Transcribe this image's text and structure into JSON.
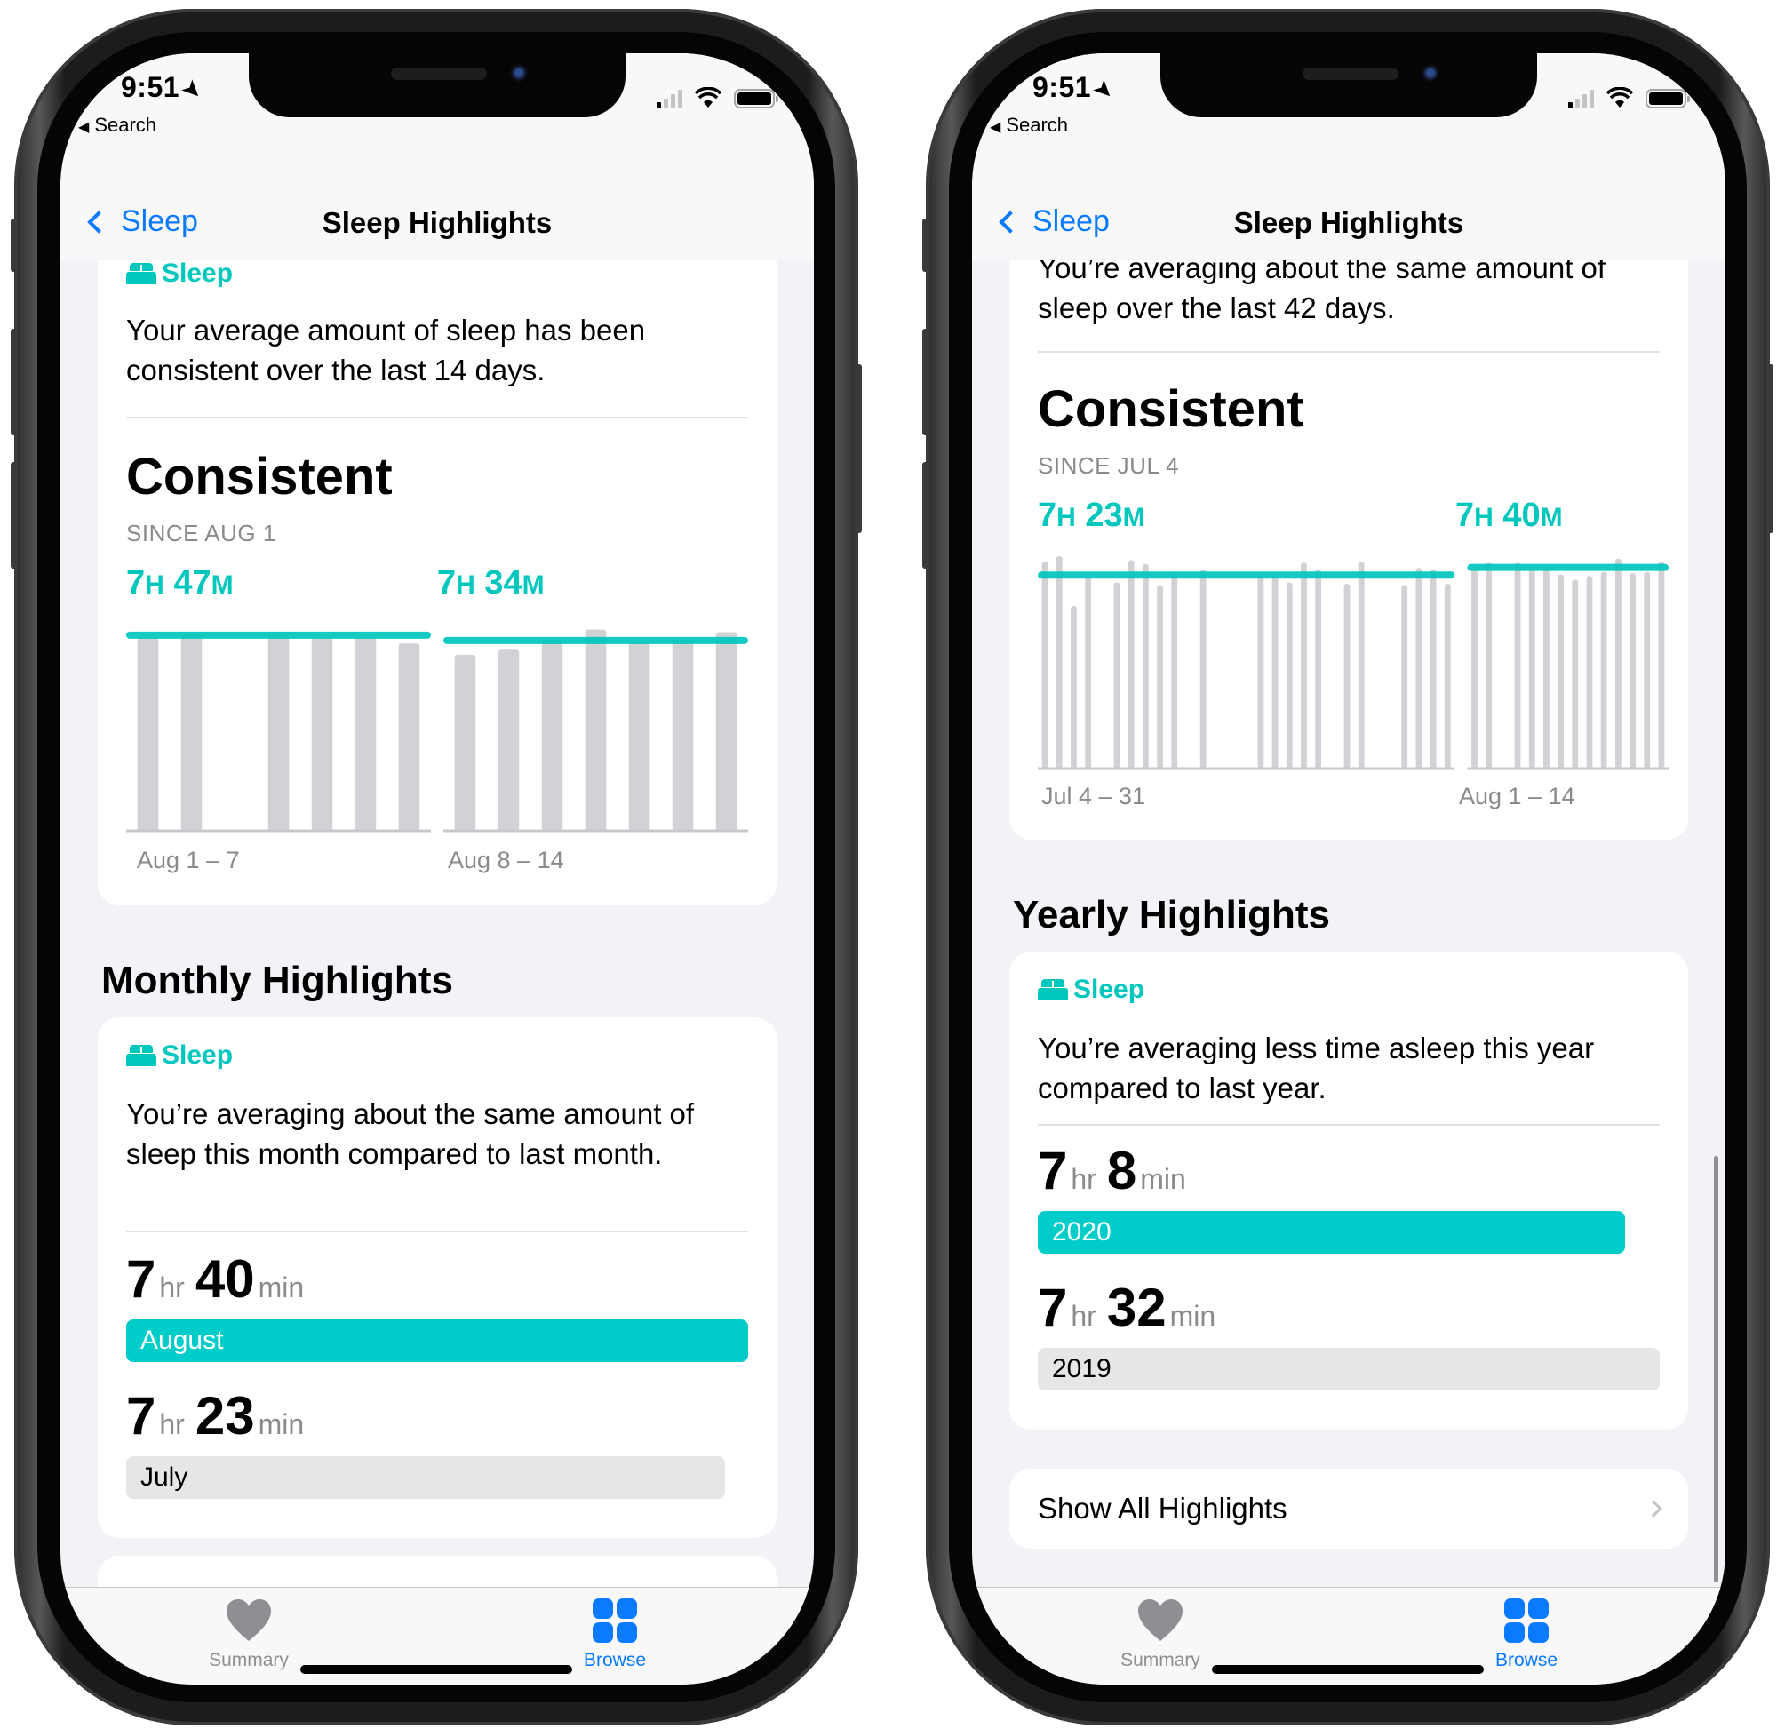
{
  "phones": [
    {
      "status": {
        "time": "9:51",
        "back_app": "Search"
      },
      "nav": {
        "back_label": "Sleep",
        "title": "Sleep Highlights"
      },
      "trend_card": {
        "category": "Sleep",
        "description": "Your average amount of sleep has been consistent over the last 14 days.",
        "status": "Consistent",
        "since": "SINCE AUG 1",
        "periods": [
          {
            "avg_h": "7",
            "avg_m": "47",
            "label": "Aug 1 – 7"
          },
          {
            "avg_h": "7",
            "avg_m": "34",
            "label": "Aug 8 – 14"
          }
        ]
      },
      "section_title": "Monthly Highlights",
      "compare_card": {
        "category": "Sleep",
        "description": "You’re averaging about the same amount of sleep this month compared to last month.",
        "rows": [
          {
            "hr": "7",
            "min": "40",
            "label": "August",
            "fraction": 1.0,
            "current": true
          },
          {
            "hr": "7",
            "min": "23",
            "label": "July",
            "fraction": 0.963,
            "current": false
          }
        ]
      },
      "tabs": [
        {
          "label": "Summary",
          "icon": "heart-icon",
          "active": false
        },
        {
          "label": "Browse",
          "icon": "grid-icon",
          "active": true
        }
      ]
    },
    {
      "status": {
        "time": "9:51",
        "back_app": "Search"
      },
      "nav": {
        "back_label": "Sleep",
        "title": "Sleep Highlights"
      },
      "trend_card": {
        "category": "Sleep",
        "description": "You’re averaging about the same amount of sleep over the last 42 days.",
        "status": "Consistent",
        "since": "SINCE JUL 4",
        "periods": [
          {
            "avg_h": "7",
            "avg_m": "23",
            "label": "Jul 4 – 31"
          },
          {
            "avg_h": "7",
            "avg_m": "40",
            "label": "Aug 1 – 14"
          }
        ]
      },
      "section_title": "Yearly Highlights",
      "compare_card": {
        "category": "Sleep",
        "description": "You’re averaging less time asleep this year compared to last year.",
        "rows": [
          {
            "hr": "7",
            "min": "8",
            "label": "2020",
            "fraction": 0.944,
            "current": true
          },
          {
            "hr": "7",
            "min": "32",
            "label": "2019",
            "fraction": 1.0,
            "current": false
          }
        ]
      },
      "show_all_label": "Show All Highlights",
      "tabs": [
        {
          "label": "Summary",
          "icon": "heart-icon",
          "active": false
        },
        {
          "label": "Browse",
          "icon": "grid-icon",
          "active": true
        }
      ]
    }
  ],
  "colors": {
    "accent_teal": "#00c7be",
    "ios_blue": "#0a7aff",
    "bar_gray": "#d1d1d6"
  },
  "chart_data": [
    {
      "type": "bar",
      "title": "Consistent — SINCE AUG 1",
      "unit": "hours",
      "groups": [
        {
          "label": "Aug 1 – 7",
          "average": 7.78,
          "values": [
            7.7,
            7.8,
            null,
            7.85,
            7.7,
            7.72,
            7.45
          ]
        },
        {
          "label": "Aug 8 – 14",
          "average": 7.57,
          "values": [
            7.0,
            7.2,
            7.6,
            8.0,
            7.5,
            7.6,
            7.9
          ]
        }
      ],
      "ylim": [
        0,
        8.2
      ],
      "grid": false
    },
    {
      "type": "bar",
      "title": "Consistent — SINCE JUL 4",
      "unit": "hours",
      "groups": [
        {
          "label": "Jul 4 – 31",
          "average": 7.38,
          "values": [
            7.9,
            8.1,
            6.2,
            7.3,
            null,
            7.1,
            7.95,
            7.8,
            7.0,
            7.4,
            null,
            7.6,
            null,
            null,
            null,
            7.35,
            7.3,
            7.1,
            7.85,
            7.6,
            null,
            7.05,
            7.9,
            null,
            null,
            7.0,
            7.65,
            7.6,
            7.05
          ]
        },
        {
          "label": "Aug 1 – 14",
          "average": 7.67,
          "values": [
            7.6,
            7.85,
            null,
            7.85,
            7.6,
            7.65,
            7.4,
            7.2,
            7.35,
            7.5,
            8.0,
            7.45,
            7.5,
            7.9
          ]
        }
      ],
      "ylim": [
        0,
        8.2
      ],
      "grid": false
    }
  ]
}
